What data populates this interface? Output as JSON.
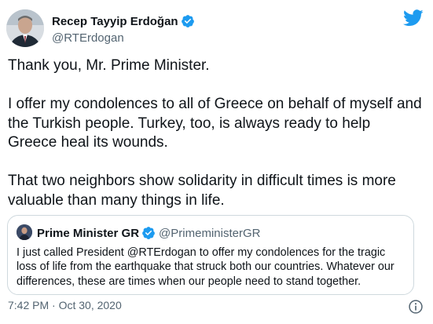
{
  "author": {
    "display_name": "Recep Tayyip Erdoğan",
    "handle": "@RTErdogan",
    "verified": true
  },
  "tweet": {
    "paragraphs": [
      "Thank you, Mr. Prime Minister.",
      "I offer my condolences to all of Greece on behalf of myself and the Turkish people. Turkey, too, is always ready to help Greece heal its wounds.",
      "That two neighbors show solidarity in difficult times is more valuable than many things in life."
    ],
    "timestamp": "7:42 PM · Oct 30, 2020"
  },
  "quoted": {
    "display_name": "Prime Minister GR",
    "handle": "@PrimeministerGR",
    "verified": true,
    "text": "I just called President @RTErdogan to offer my condolences for the tragic loss of life from the earthquake that struck both our countries. Whatever our differences, these are times when our people need to stand together."
  },
  "icons": {
    "brand": "twitter-bird-icon",
    "verified": "verified-badge-icon",
    "info": "info-icon"
  },
  "colors": {
    "brand": "#1d9bf0",
    "text_primary": "#0f1419",
    "text_secondary": "#536471",
    "border": "#cfd9de"
  }
}
